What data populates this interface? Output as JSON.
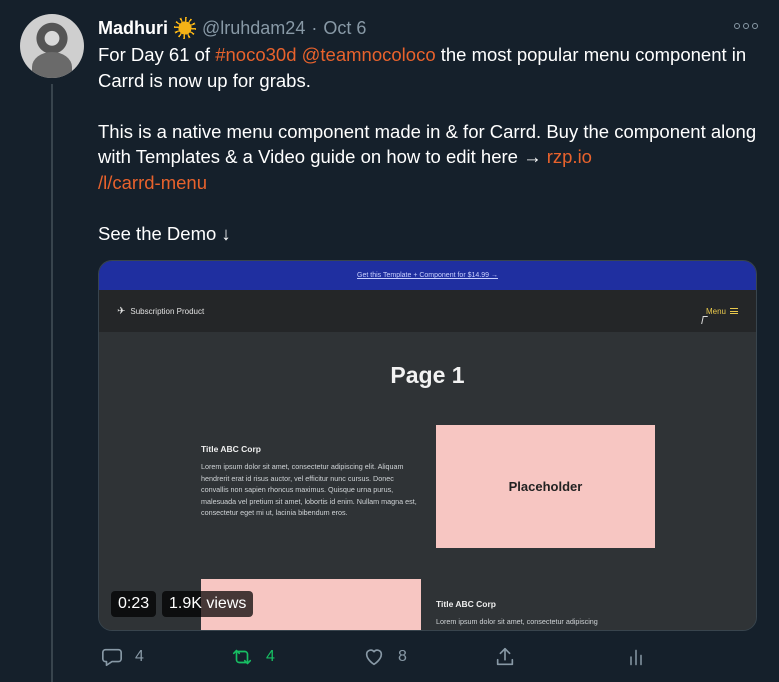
{
  "tweet": {
    "author_name": "Madhuri",
    "handle": "@lruhdam24",
    "separator": "·",
    "date": "Oct 6",
    "text": {
      "line1_before": "For Day 61 of ",
      "hashtag": "#noco30d",
      "mention": "@teamnocoloco",
      "line1_after": " the most popular menu component in Carrd is now up for grabs.",
      "para2_before": "This is a native menu component made in & for Carrd. Buy the component along with Templates & a Video guide on how to edit here → ",
      "link_part1": "rzp.io",
      "link_part2": "/l/carrd-menu",
      "para3": "See the Demo ↓"
    }
  },
  "media": {
    "promo_bar": "Get this Template + Component for $14.99 →",
    "brand": "Subscription Product",
    "menu_label": "Menu",
    "page_title": "Page 1",
    "block1_title": "Title ABC Corp",
    "block1_text": "Lorem ipsum dolor sit amet, consectetur adipiscing elit. Aliquam hendrerit erat id risus auctor, vel efficitur nunc cursus. Donec convallis non sapien rhoncus maximus. Quisque urna purus, malesuada vel pretium sit amet, lobortis id enim. Nullam magna est, consectetur eget mi ut, lacinia bibendum eros.",
    "placeholder": "Placeholder",
    "block2_title": "Title ABC Corp",
    "block2_text": "Lorem ipsum dolor sit amet, consectetur adipiscing",
    "duration": "0:23",
    "views": "1.9K views"
  },
  "actions": {
    "reply_count": "4",
    "retweet_count": "4",
    "like_count": "8"
  },
  "colors": {
    "background": "#15202b",
    "link": "#e8622c",
    "muted": "#8899a6",
    "retweet": "#17bf63",
    "placeholder": "#f7c6c2",
    "promo_bar": "#1f2fa0"
  }
}
